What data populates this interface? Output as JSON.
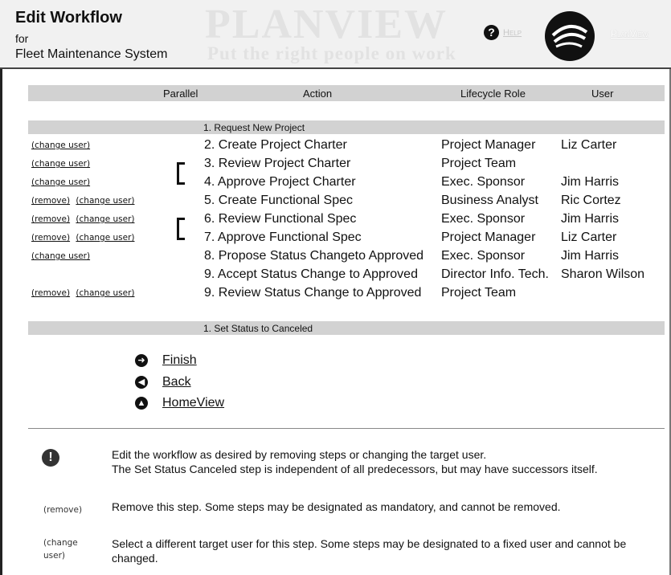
{
  "header": {
    "title": "Edit Workflow",
    "for_label": "for",
    "project": "Fleet Maintenance System",
    "watermark_brand": "PLANVIEW",
    "watermark_tagline": "Put the right people on work",
    "help_link": "Help",
    "brand_link": "PlanView"
  },
  "columns": {
    "parallel": "Parallel",
    "action": "Action",
    "role": "Lifecycle Role",
    "user": "User"
  },
  "groups": [
    "1. Request New Project",
    "1. Set Status to Canceled"
  ],
  "link_labels": {
    "remove": "(remove)",
    "change_user": "(change user)"
  },
  "steps": [
    {
      "action": "2. Create Project Charter",
      "role": "Project Manager",
      "user": "Liz Carter"
    },
    {
      "action": "3. Review Project Charter",
      "role": "Project Team",
      "user": ""
    },
    {
      "action": "4. Approve Project Charter",
      "role": "Exec. Sponsor",
      "user": "Jim Harris"
    },
    {
      "action": "5. Create Functional Spec",
      "role": "Business Analyst",
      "user": "Ric Cortez"
    },
    {
      "action": "6. Review Functional Spec",
      "role": "Exec. Sponsor",
      "user": "Jim Harris"
    },
    {
      "action": "7. Approve Functional Spec",
      "role": "Project Manager",
      "user": "Liz Carter"
    },
    {
      "action": "8. Propose Status Changeto Approved",
      "role": "Exec. Sponsor",
      "user": "Jim Harris"
    },
    {
      "action": "9. Accept Status Change to Approved",
      "role": "Director Info. Tech.",
      "user": "Sharon Wilson"
    },
    {
      "action": "9. Review Status Change to Approved",
      "role": "Project Team",
      "user": ""
    }
  ],
  "nav": {
    "finish": "Finish",
    "back": "Back",
    "homeview": "HomeView"
  },
  "help": {
    "intro_line1": "Edit the workflow as desired by removing steps or changing the target user.",
    "intro_line2": "The Set Status Canceled step is independent of all predecessors, but may have successors itself.",
    "remove_label": "(remove)",
    "remove_text": "Remove this step. Some steps may be designated as mandatory, and cannot be removed.",
    "change_label_1": "(change",
    "change_label_2": "user)",
    "change_text": "Select a different target user for this step. Some steps may be designated to a fixed user and cannot be changed."
  }
}
